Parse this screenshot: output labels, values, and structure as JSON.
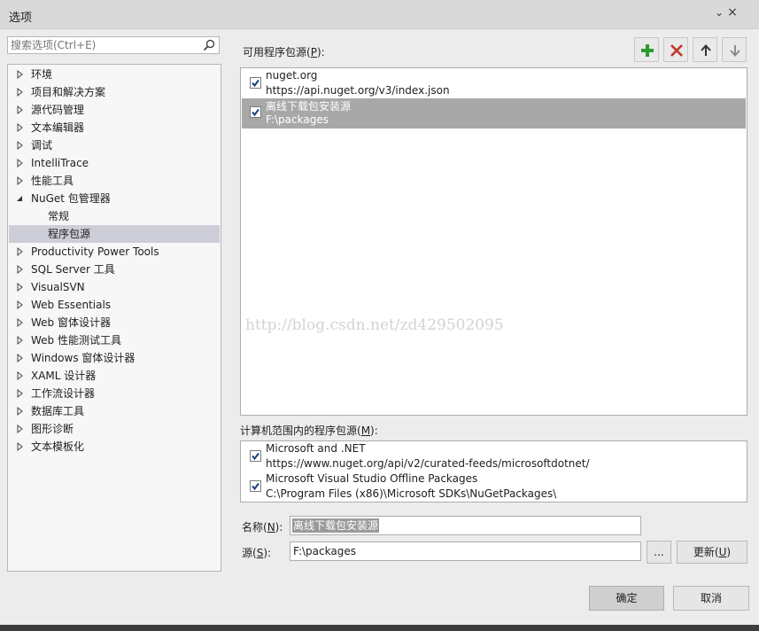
{
  "window": {
    "title": "选项",
    "minimize_glyph": "⌄",
    "close_glyph": "×"
  },
  "search": {
    "placeholder": "搜索选项(Ctrl+E)",
    "icon": "search-icon"
  },
  "tree": [
    {
      "label": "环境",
      "expandable": true
    },
    {
      "label": "项目和解决方案",
      "expandable": true
    },
    {
      "label": "源代码管理",
      "expandable": true
    },
    {
      "label": "文本编辑器",
      "expandable": true
    },
    {
      "label": "调试",
      "expandable": true
    },
    {
      "label": "IntelliTrace",
      "expandable": true
    },
    {
      "label": "性能工具",
      "expandable": true
    },
    {
      "label": "NuGet 包管理器",
      "expanded": true
    },
    {
      "label": "常规",
      "child": true
    },
    {
      "label": "程序包源",
      "child": true,
      "selected": true
    },
    {
      "label": "Productivity Power Tools",
      "expandable": true
    },
    {
      "label": "SQL Server 工具",
      "expandable": true
    },
    {
      "label": "VisualSVN",
      "expandable": true
    },
    {
      "label": "Web Essentials",
      "expandable": true
    },
    {
      "label": "Web 窗体设计器",
      "expandable": true
    },
    {
      "label": "Web 性能测试工具",
      "expandable": true
    },
    {
      "label": "Windows 窗体设计器",
      "expandable": true
    },
    {
      "label": "XAML 设计器",
      "expandable": true
    },
    {
      "label": "工作流设计器",
      "expandable": true
    },
    {
      "label": "数据库工具",
      "expandable": true
    },
    {
      "label": "图形诊断",
      "expandable": true
    },
    {
      "label": "文本模板化",
      "expandable": true
    }
  ],
  "available_sources": {
    "label_pre": "可用程序包源(",
    "label_key": "P",
    "label_post": "):",
    "items": [
      {
        "name": "nuget.org",
        "url": "https://api.nuget.org/v3/index.json",
        "checked": true,
        "selected": false
      },
      {
        "name": "离线下载包安装源",
        "url": "F:\\packages",
        "checked": true,
        "selected": true
      }
    ]
  },
  "toolbar": {
    "add_icon": "plus-icon",
    "remove_icon": "x-icon",
    "up_icon": "arrow-up-icon",
    "down_icon": "arrow-down-icon",
    "add_color": "#2e9a2e",
    "remove_color": "#c0392b"
  },
  "watermark": "http://blog.csdn.net/zd429502095",
  "machine_sources": {
    "label_pre": "计算机范围内的程序包源(",
    "label_key": "M",
    "label_post": "):",
    "items": [
      {
        "name": "Microsoft and .NET",
        "url": "https://www.nuget.org/api/v2/curated-feeds/microsoftdotnet/",
        "checked": true
      },
      {
        "name": "Microsoft Visual Studio Offline Packages",
        "url": "C:\\Program Files (x86)\\Microsoft SDKs\\NuGetPackages\\",
        "checked": true
      }
    ]
  },
  "form": {
    "name_pre": "名称(",
    "name_key": "N",
    "name_post": "):",
    "name_value": "离线下载包安装源",
    "source_pre": "源(",
    "source_key": "S",
    "source_post": "):",
    "source_value": "F:\\packages",
    "browse_label": "...",
    "update_pre": "更新(",
    "update_key": "U",
    "update_post": ")"
  },
  "buttons": {
    "ok": "确定",
    "cancel": "取消"
  }
}
